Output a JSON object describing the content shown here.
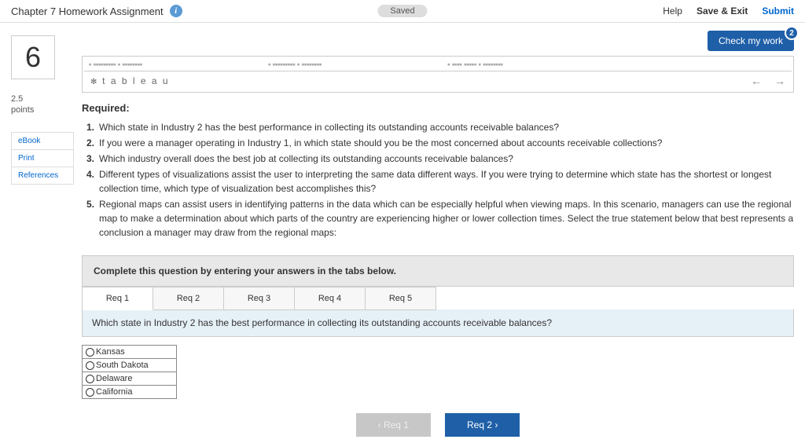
{
  "header": {
    "title": "Chapter 7 Homework Assignment",
    "saved": "Saved",
    "help": "Help",
    "save_exit": "Save & Exit",
    "submit": "Submit"
  },
  "check": {
    "label": "Check my work",
    "badge": "2"
  },
  "question": {
    "number": "6",
    "points_val": "2.5",
    "points_label": "points"
  },
  "sidelinks": {
    "ebook": "eBook",
    "print": "Print",
    "refs": "References"
  },
  "tableau": {
    "logo": "t a b l e a u",
    "back": "←",
    "fwd": "→"
  },
  "required": {
    "title": "Required:",
    "items": [
      "Which state in Industry 2 has the best performance in collecting its outstanding accounts receivable balances?",
      "If you were a manager operating in Industry 1, in which state should you be the most concerned about accounts receivable collections?",
      "Which industry overall does the best job at collecting its outstanding accounts receivable balances?",
      "Different types of visualizations assist the user to interpreting the same data different ways. If you were trying to determine which state has the shortest or longest collection time, which type of visualization best accomplishes this?",
      "Regional maps can assist users in identifying patterns in the data which can be especially helpful when viewing maps. In this scenario, managers can use the regional map to make a determination about which parts of the country are experiencing higher or lower collection times. Select the true statement below that best represents a conclusion a manager may draw from the regional maps:"
    ]
  },
  "complete": "Complete this question by entering your answers in the tabs below.",
  "tabs": [
    "Req 1",
    "Req 2",
    "Req 3",
    "Req 4",
    "Req 5"
  ],
  "current_q": "Which state in Industry 2 has the best performance in collecting its outstanding accounts receivable balances?",
  "options": [
    "Kansas",
    "South Dakota",
    "Delaware",
    "California"
  ],
  "nav": {
    "prev": "‹  Req 1",
    "next": "Req 2  ›"
  }
}
